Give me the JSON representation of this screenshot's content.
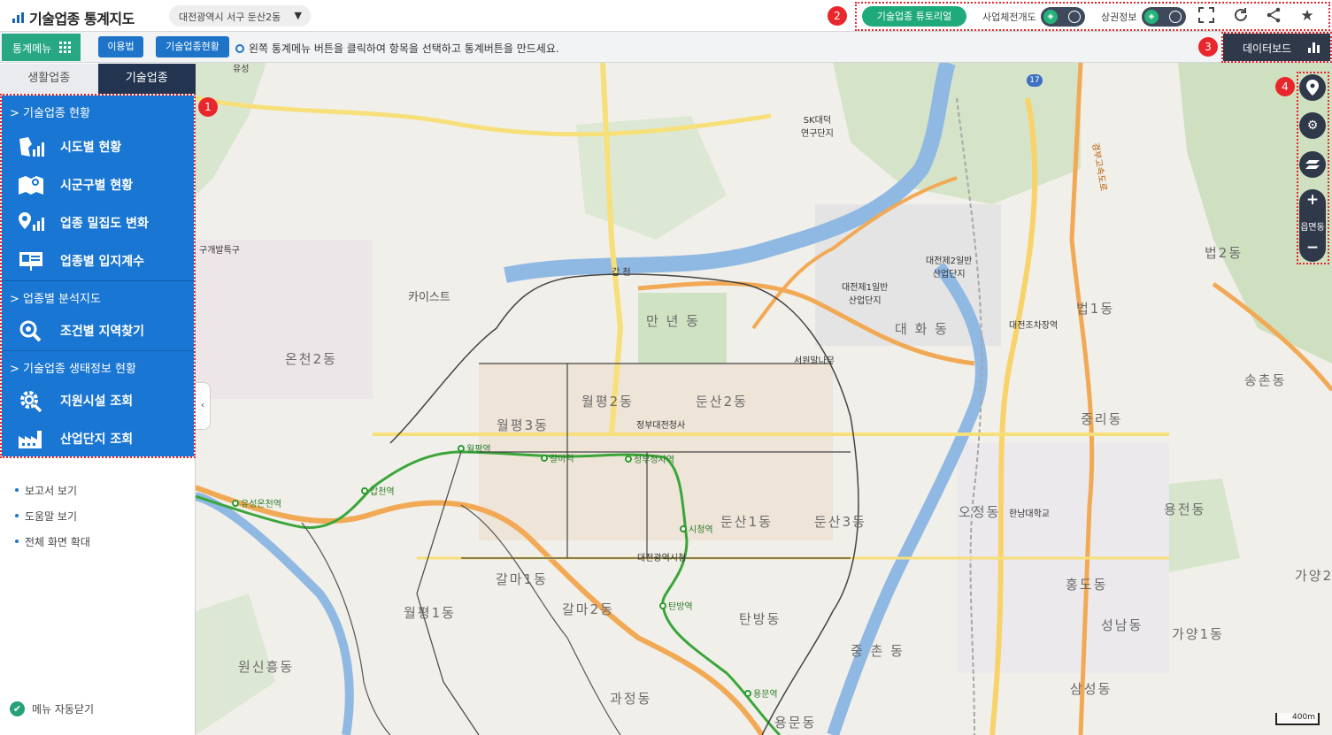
{
  "header": {
    "app_title": "기술업종 통계지도",
    "region": "대전광역시 서구 둔산2동",
    "region_arrow": "▼",
    "tutorial_label": "기술업종 튜토리얼",
    "toggle1_label": "사업체전개도",
    "toggle2_label": "상권정보"
  },
  "subbar": {
    "statmenu_label": "통계메뉴",
    "usage_label": "이용법",
    "status_label": "기술업종현황",
    "info_text": "왼쪽 통계메뉴 버튼을 클릭하여 항목을 선택하고 통계버튼을 만드세요.",
    "databoard_label": "데이터보드"
  },
  "badges": [
    "1",
    "2",
    "3",
    "4"
  ],
  "tabs": {
    "inactive": "생활업종",
    "active": "기술업종"
  },
  "menu": {
    "section1": "기술업종 현황",
    "section2": "업종별 분석지도",
    "section3": "기술업종 생태정보 현황",
    "items": [
      "시도별 현황",
      "시군구별 현황",
      "업종 밀집도 변화",
      "업종별 입지계수",
      "조건별 지역찾기",
      "지원시설 조회",
      "산업단지 조회"
    ]
  },
  "links": [
    "보고서 보기",
    "도움말 보기",
    "전체 화면 확대"
  ],
  "auto_close_label": "메뉴 자동닫기",
  "map": {
    "labels": {
      "onchon2": "온천2동",
      "kaist": "카이스트",
      "gap": "갑 천",
      "mannyeon": "만 년 동",
      "wolpyeong2": "월평2동",
      "dunsan2": "둔산2동",
      "wolpyeong3": "월평3동",
      "govcomplex": "정부대전청사",
      "dunsan1": "둔산1동",
      "dunsan3": "둔산3동",
      "galma1": "갈마1동",
      "galma2": "갈마2동",
      "wolpyeong1": "월평1동",
      "tanbang": "탄방동",
      "cityhall": "대전광역시청",
      "wonsinheung": "원신흥동",
      "gwajeong": "과정동",
      "yongmun": "용문동",
      "daehwa": "대 화 동",
      "beop1": "법1동",
      "beop2": "법2동",
      "songchon": "송촌동",
      "jungri": "중리동",
      "ojeong": "오정동",
      "hannam": "한남대학교",
      "yongjeon": "용전동",
      "hongdo": "홍도동",
      "seongnam": "성남동",
      "gayang1": "가양1동",
      "gayang2": "가양2동",
      "samseong": "삼성동",
      "jungchon": "중 촌 동",
      "skresearch": "SK대덕\n연구단지",
      "ind1": "대전제1일반\n산업단지",
      "ind2": "대전제2일반\n산업단지",
      "seowon": "서원말나무",
      "gudevelop": "구개발특구",
      "yuseong_ic": "유성",
      "daejeonjochajang": "대전조차장역",
      "expressway": "경부고속도로",
      "route17": "17"
    },
    "stations": {
      "wolpyeong": "월평역",
      "galma": "갈마역",
      "govstation": "정부청사역",
      "gapcheon": "갑천역",
      "yuseongoncheon": "유성온천역",
      "cityhall": "시청역",
      "tanbang": "탄방역",
      "yongmun": "용문역"
    },
    "zoom_label": "읍면동",
    "scale_label": "400m",
    "colors": {
      "river": "#8fb8e3",
      "green": "#cfe0c3",
      "road_yellow": "#f7e07a",
      "road_orange": "#f2a955",
      "metro": "#3aa63a",
      "boundary": "#444444"
    }
  }
}
